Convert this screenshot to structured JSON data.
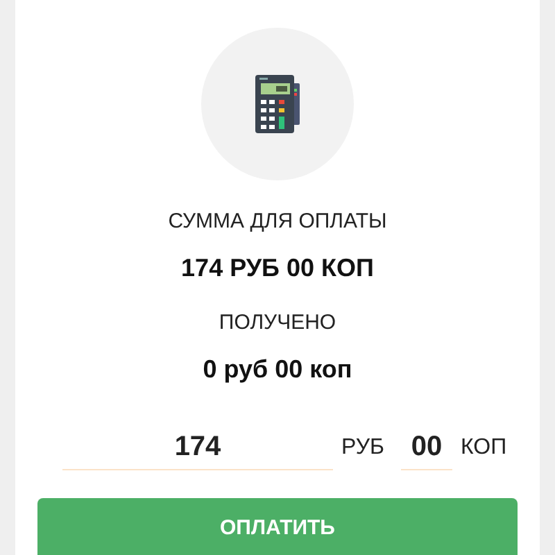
{
  "amount_label": "СУММА ДЛЯ ОПЛАТЫ",
  "amount": "174 РУБ 00 КОП",
  "received_label": "ПОЛУЧЕНО",
  "received": "0 руб 00 коп",
  "rub_field": {
    "value": "174"
  },
  "rub_unit": "РУБ",
  "kop_field": {
    "value": "00"
  },
  "kop_unit": "КОП",
  "pay_button": "ОПЛАТИТЬ"
}
